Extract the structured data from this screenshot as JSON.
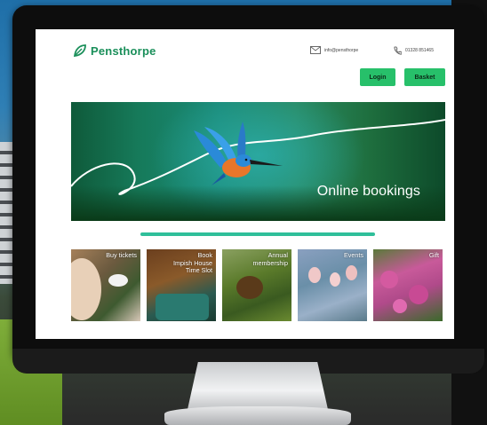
{
  "header": {
    "logo_text": "Pensthorpe",
    "email": "info@pensthorpe",
    "phone": "01328 851465",
    "login_label": "Login",
    "basket_label": "Basket"
  },
  "hero": {
    "title": "Online bookings"
  },
  "tiles": [
    {
      "label": "Buy tickets"
    },
    {
      "label": "Book\nImpish House\nTime Slot"
    },
    {
      "label": "Annual\nmembership"
    },
    {
      "label": "Events"
    },
    {
      "label": "Gift"
    }
  ],
  "colors": {
    "brand": "#1a8f5a",
    "button": "#27c06a",
    "divider": "#2fbf9a"
  }
}
